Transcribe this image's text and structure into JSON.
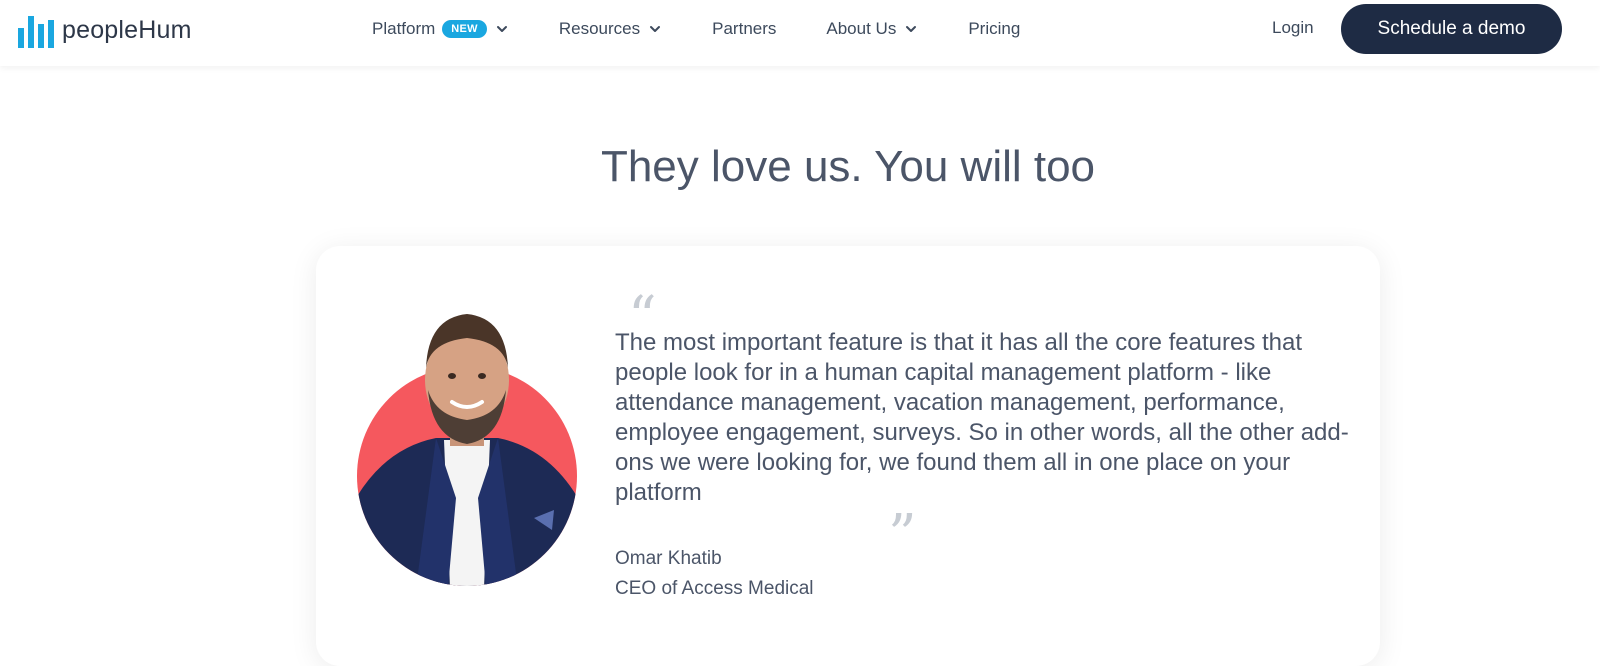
{
  "brand": {
    "name": "peopleHum",
    "accent": "#1aa7e0",
    "dark": "#1e2b44"
  },
  "nav": {
    "items": [
      {
        "label": "Platform",
        "badge": "NEW",
        "has_dropdown": true
      },
      {
        "label": "Resources",
        "has_dropdown": true
      },
      {
        "label": "Partners",
        "has_dropdown": false
      },
      {
        "label": "About Us",
        "has_dropdown": true
      },
      {
        "label": "Pricing",
        "has_dropdown": false
      }
    ],
    "login_label": "Login",
    "cta_label": "Schedule a demo"
  },
  "testimonials": {
    "heading": "They love us. You will too",
    "quote": "The most important feature is that it has all the core features that people look for in a human capital management platform - like attendance management, vacation management, performance, employee engagement, surveys. So in other words, all the other add-ons we were looking for, we found them all in one place on your platform",
    "author_name": "Omar Khatib",
    "author_role": "CEO of Access Medical",
    "open_quote_mark": "“",
    "close_quote_mark": "”",
    "avatar_bg_color": "#f5585e"
  }
}
